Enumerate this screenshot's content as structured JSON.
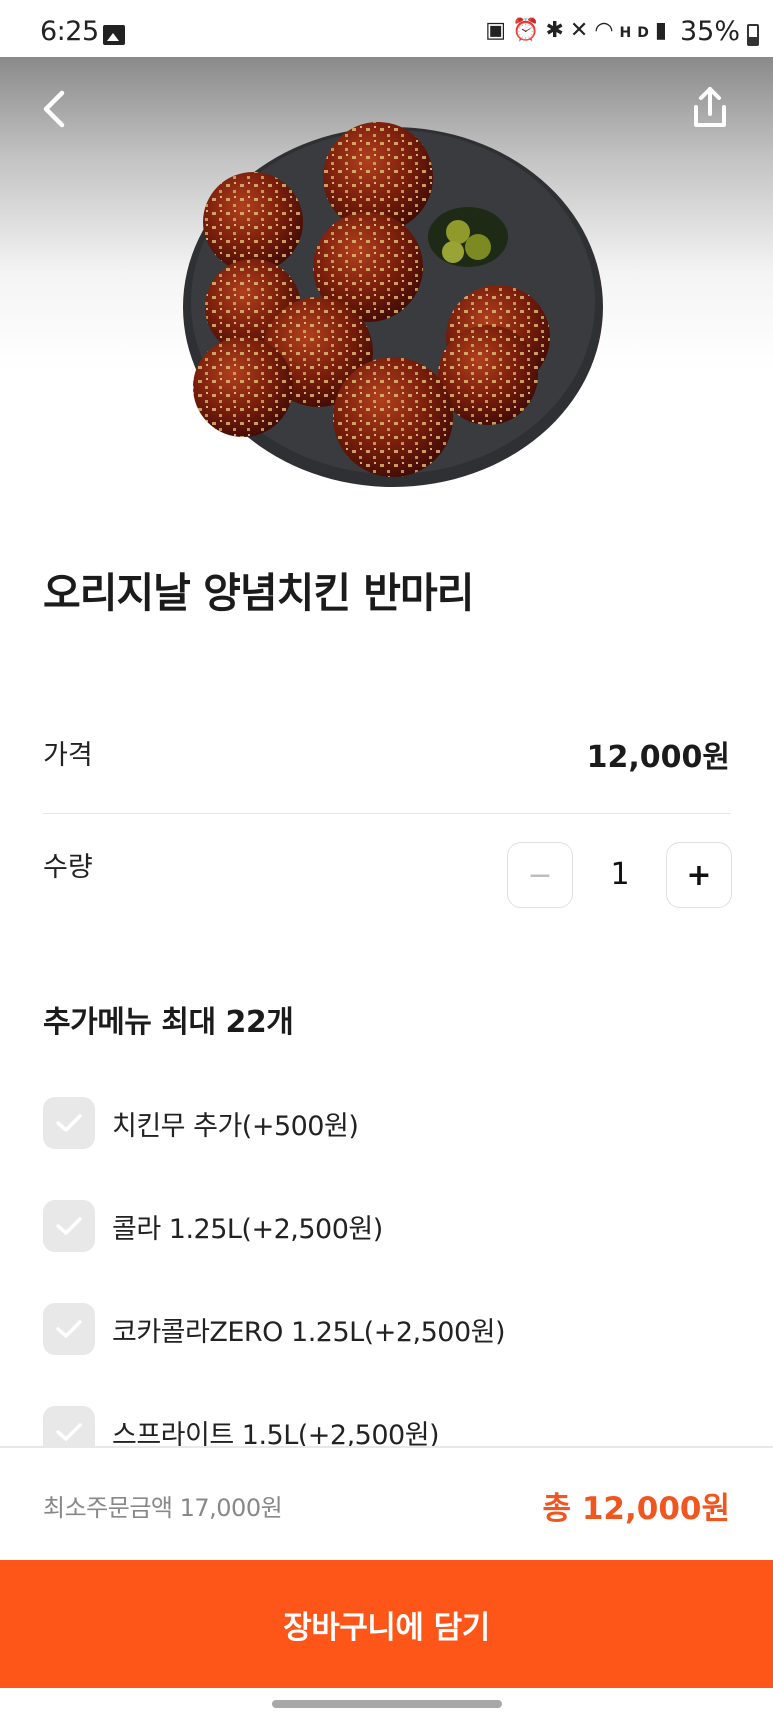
{
  "status_bar": {
    "time": "6:25",
    "icons": [
      "gallery-icon",
      "battery-saver-icon",
      "alarm-icon",
      "bluetooth-icon",
      "mute-icon",
      "wifi-icon",
      "hd-voice-icon",
      "signal-icon"
    ],
    "battery": "35%"
  },
  "header": {
    "back_icon": "chevron-left-icon",
    "share_icon": "share-icon",
    "image": "fried-chicken-platter"
  },
  "product": {
    "title": "오리지날 양념치킨 반마리",
    "price_label": "가격",
    "price": "12,000원",
    "quantity_label": "수량",
    "quantity": "1",
    "minus": "−",
    "plus": "+"
  },
  "options": {
    "title": "추가메뉴 최대 22개",
    "items": [
      {
        "label": "치킨무 추가(+500원)",
        "checked": false
      },
      {
        "label": "콜라 1.25L(+2,500원)",
        "checked": false
      },
      {
        "label": "코카콜라ZERO 1.25L(+2,500원)",
        "checked": false
      },
      {
        "label": "스프라이트 1.5L(+2,500원)",
        "checked": false
      }
    ]
  },
  "footer": {
    "min_order": "최소주문금액 17,000원",
    "total": "총 12,000원",
    "cart_button": "장바구니에 담기"
  },
  "colors": {
    "accent": "#fe5519",
    "total_text": "#f0561f",
    "checkbox_bg": "#e8e8e8"
  }
}
